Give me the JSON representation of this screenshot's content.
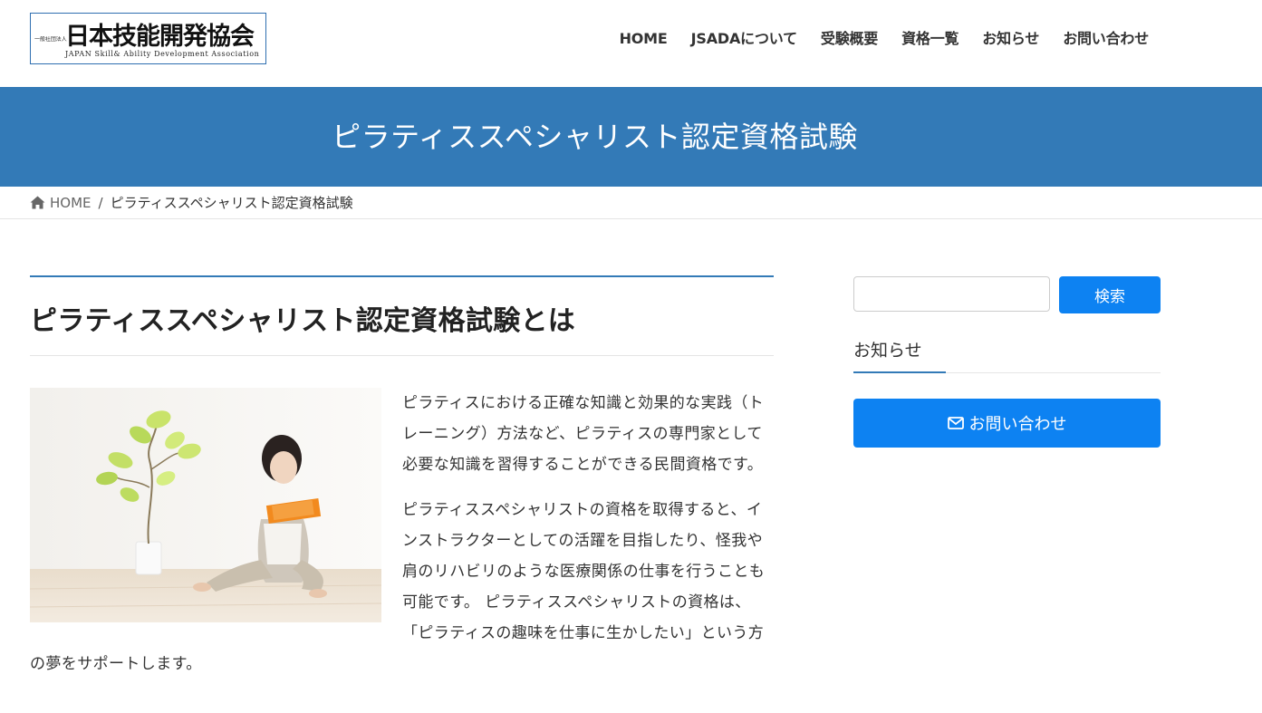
{
  "header": {
    "logo": {
      "small": "一般社団法人",
      "main": "日本技能開発協会",
      "sub": "JAPAN  Skill&  Ability  Development  Association"
    },
    "nav": [
      "HOME",
      "JSADAについて",
      "受験概要",
      "資格一覧",
      "お知らせ",
      "お問い合わせ"
    ]
  },
  "page_header": {
    "title": "ピラティススペシャリスト認定資格試験"
  },
  "breadcrumb": {
    "home": "HOME",
    "separator": "/",
    "current": "ピラティススペシャリスト認定資格試験",
    "home_icon": "home-icon"
  },
  "main": {
    "heading": "ピラティススペシャリスト認定資格試験とは",
    "image_alt": "woman-reading-book-photo",
    "paragraphs": [
      "ピラティスにおける正確な知識と効果的な実践（トレーニング）方法など、ピラティスの専門家として必要な知識を習得することができる民間資格です。",
      "ピラティススペシャリストの資格を取得すると、インストラクターとしての活躍を目指したり、怪我や肩のリハビリのような医療関係の仕事を行うことも可能です。 ピラティススペシャリストの資格は、「ピラティスの趣味を仕事に生かしたい」という方の夢をサポートします。"
    ]
  },
  "sidebar": {
    "search_button": "検索",
    "search_value": "",
    "widget_title": "お知らせ",
    "contact_button": "お問い合わせ",
    "contact_icon": "envelope-icon"
  },
  "colors": {
    "brand_blue": "#337ab7",
    "button_blue": "#0d82f2"
  }
}
